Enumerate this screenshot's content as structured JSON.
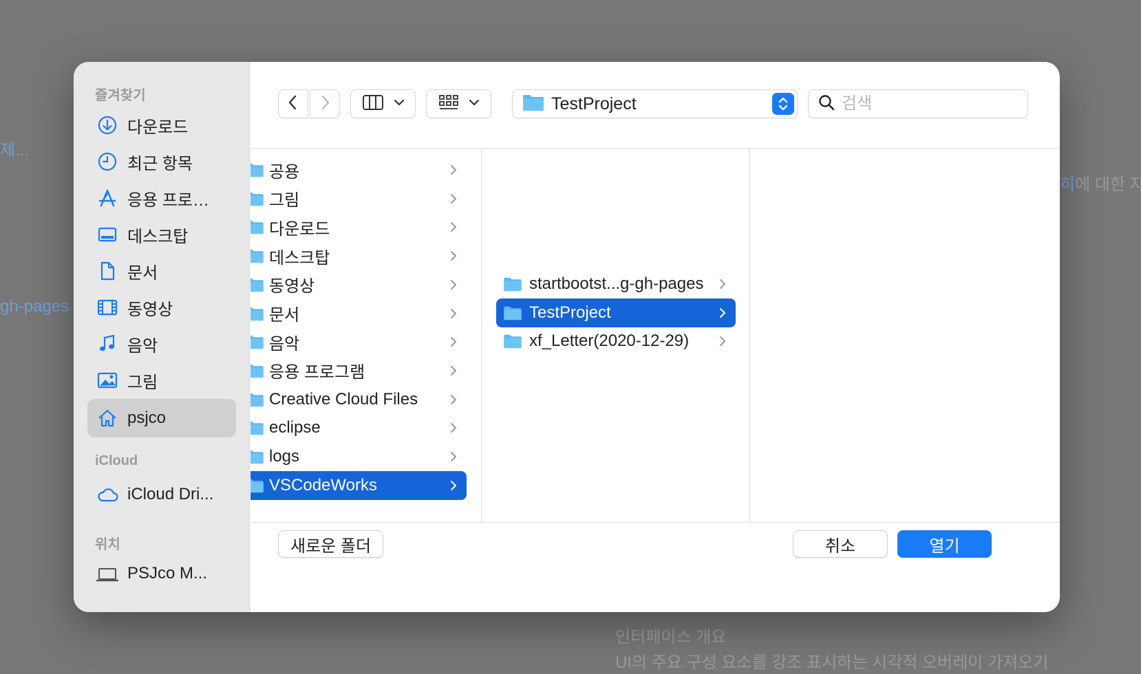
{
  "background": {
    "left_text_1": "제...",
    "left_text_2": "gh-pages",
    "right_link": "히",
    "right_text": "에 대한 자",
    "bottom_line_1": "인터페이스 개요",
    "bottom_line_2": "UI의 주요 구성 요소를 강조 표시하는 시각적 오버레이 가져오기"
  },
  "sidebar": {
    "favorites_title": "즐겨찾기",
    "favorites": [
      {
        "label": "다운로드",
        "icon": "download-icon"
      },
      {
        "label": "최근 항목",
        "icon": "clock-icon"
      },
      {
        "label": "응용 프로…",
        "icon": "app-store-icon"
      },
      {
        "label": "데스크탑",
        "icon": "desktop-icon"
      },
      {
        "label": "문서",
        "icon": "document-icon"
      },
      {
        "label": "동영상",
        "icon": "film-icon"
      },
      {
        "label": "음악",
        "icon": "music-icon"
      },
      {
        "label": "그림",
        "icon": "photo-icon"
      },
      {
        "label": "psjco",
        "icon": "home-icon",
        "active": true
      }
    ],
    "icloud_title": "iCloud",
    "icloud_items": [
      {
        "label": "iCloud Dri...",
        "icon": "cloud-icon"
      }
    ],
    "locations_title": "위치",
    "locations": [
      {
        "label": "PSJco M...",
        "icon": "laptop-icon"
      }
    ]
  },
  "toolbar": {
    "current_folder": "TestProject",
    "search_placeholder": "검색"
  },
  "columns": {
    "col1": [
      {
        "label": "공용"
      },
      {
        "label": "그림"
      },
      {
        "label": "다운로드"
      },
      {
        "label": "데스크탑"
      },
      {
        "label": "동영상"
      },
      {
        "label": "문서"
      },
      {
        "label": "음악"
      },
      {
        "label": "응용 프로그램"
      },
      {
        "label": "Creative Cloud Files"
      },
      {
        "label": "eclipse"
      },
      {
        "label": "logs"
      },
      {
        "label": "VSCodeWorks",
        "selected": true
      }
    ],
    "col2": [
      {
        "label": "startbootst...g-gh-pages",
        "partial": true
      },
      {
        "label": "TestProject",
        "selected": true
      },
      {
        "label": "xf_Letter(2020-12-29)"
      }
    ]
  },
  "buttons": {
    "new_folder": "새로운 폴더",
    "cancel": "취소",
    "open": "열기"
  },
  "colors": {
    "accent": "#1a7cf5",
    "selection": "#1565d8",
    "folder": "#6cc4f5"
  }
}
